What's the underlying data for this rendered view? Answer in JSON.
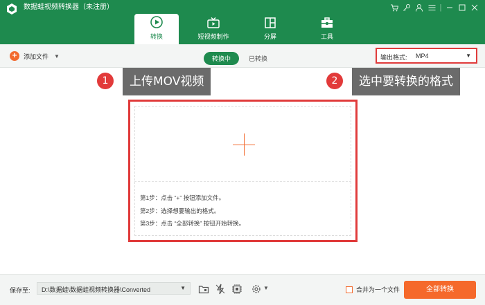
{
  "app": {
    "title": "数据蛙视频转换器（未注册）"
  },
  "tabs": [
    {
      "label": "转换",
      "icon": "convert-icon",
      "active": true
    },
    {
      "label": "短视频制作",
      "icon": "tv-icon",
      "active": false
    },
    {
      "label": "分屏",
      "icon": "split-screen-icon",
      "active": false
    },
    {
      "label": "工具",
      "icon": "toolbox-icon",
      "active": false
    }
  ],
  "toolbar": {
    "add_file_label": "添加文件",
    "segment_converting": "转换中",
    "segment_converted": "已转换",
    "output_format_label": "输出格式:",
    "output_format_value": "MP4"
  },
  "annotations": [
    {
      "number": "1",
      "text": "上传MOV视频"
    },
    {
      "number": "2",
      "text": "选中要转换的格式"
    }
  ],
  "drop_area": {
    "steps": [
      "第1步：点击 “+” 按钮添加文件。",
      "第2步：选择想要输出的格式。",
      "第3步：点击 “全部转换” 按钮开始转换。"
    ]
  },
  "bottom": {
    "save_to_label": "保存至:",
    "save_path": "D:\\数据蛙\\数据蛙视频转换器\\Converted",
    "merge_label": "合并为一个文件",
    "convert_all_label": "全部转换"
  },
  "colors": {
    "brand_green": "#1e8a4e",
    "accent_orange": "#f5692b",
    "annotation_red": "#e03b3b",
    "callout_gray": "#6b6b6b"
  }
}
